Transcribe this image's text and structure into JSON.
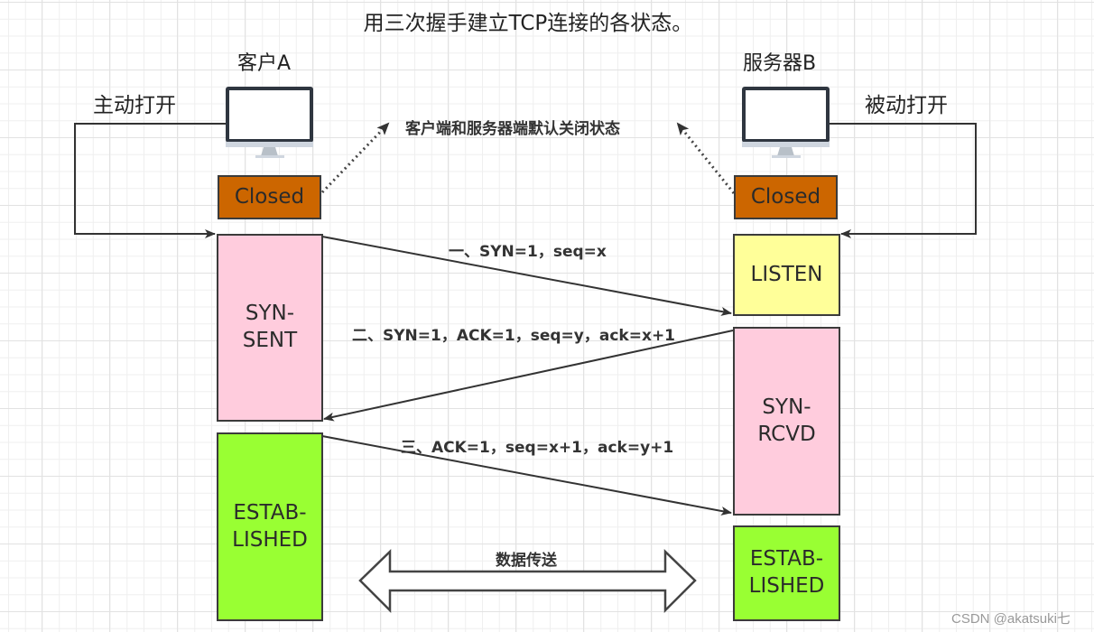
{
  "title": "用三次握手建立TCP连接的各状态。",
  "client": {
    "label": "客户A",
    "open_label": "主动打开",
    "icon": "monitor-icon",
    "states": {
      "closed": "Closed",
      "syn_sent": "SYN-\nSENT",
      "established": "ESTAB-\nLISHED"
    }
  },
  "server": {
    "label": "服务器B",
    "open_label": "被动打开",
    "icon": "monitor-icon",
    "states": {
      "closed": "Closed",
      "listen": "LISTEN",
      "syn_rcvd": "SYN-\nRCVD",
      "established": "ESTAB-\nLISHED"
    }
  },
  "default_state_note": "客户端和服务器端默认关闭状态",
  "messages": [
    {
      "step": "一",
      "text": "一、SYN=1，seq=x",
      "from": "client",
      "to": "server"
    },
    {
      "step": "二",
      "text": "二、SYN=1，ACK=1，seq=y，ack=x+1",
      "from": "server",
      "to": "client"
    },
    {
      "step": "三",
      "text": "三、ACK=1，seq=x+1，ack=y+1",
      "from": "client",
      "to": "server"
    }
  ],
  "data_transfer_label": "数据传送",
  "colors": {
    "closed": "#cc6600",
    "syn": "#ffccdd",
    "listen": "#ffff99",
    "established": "#99ff33",
    "line": "#333333"
  },
  "watermark": "CSDN @akatsuki七"
}
